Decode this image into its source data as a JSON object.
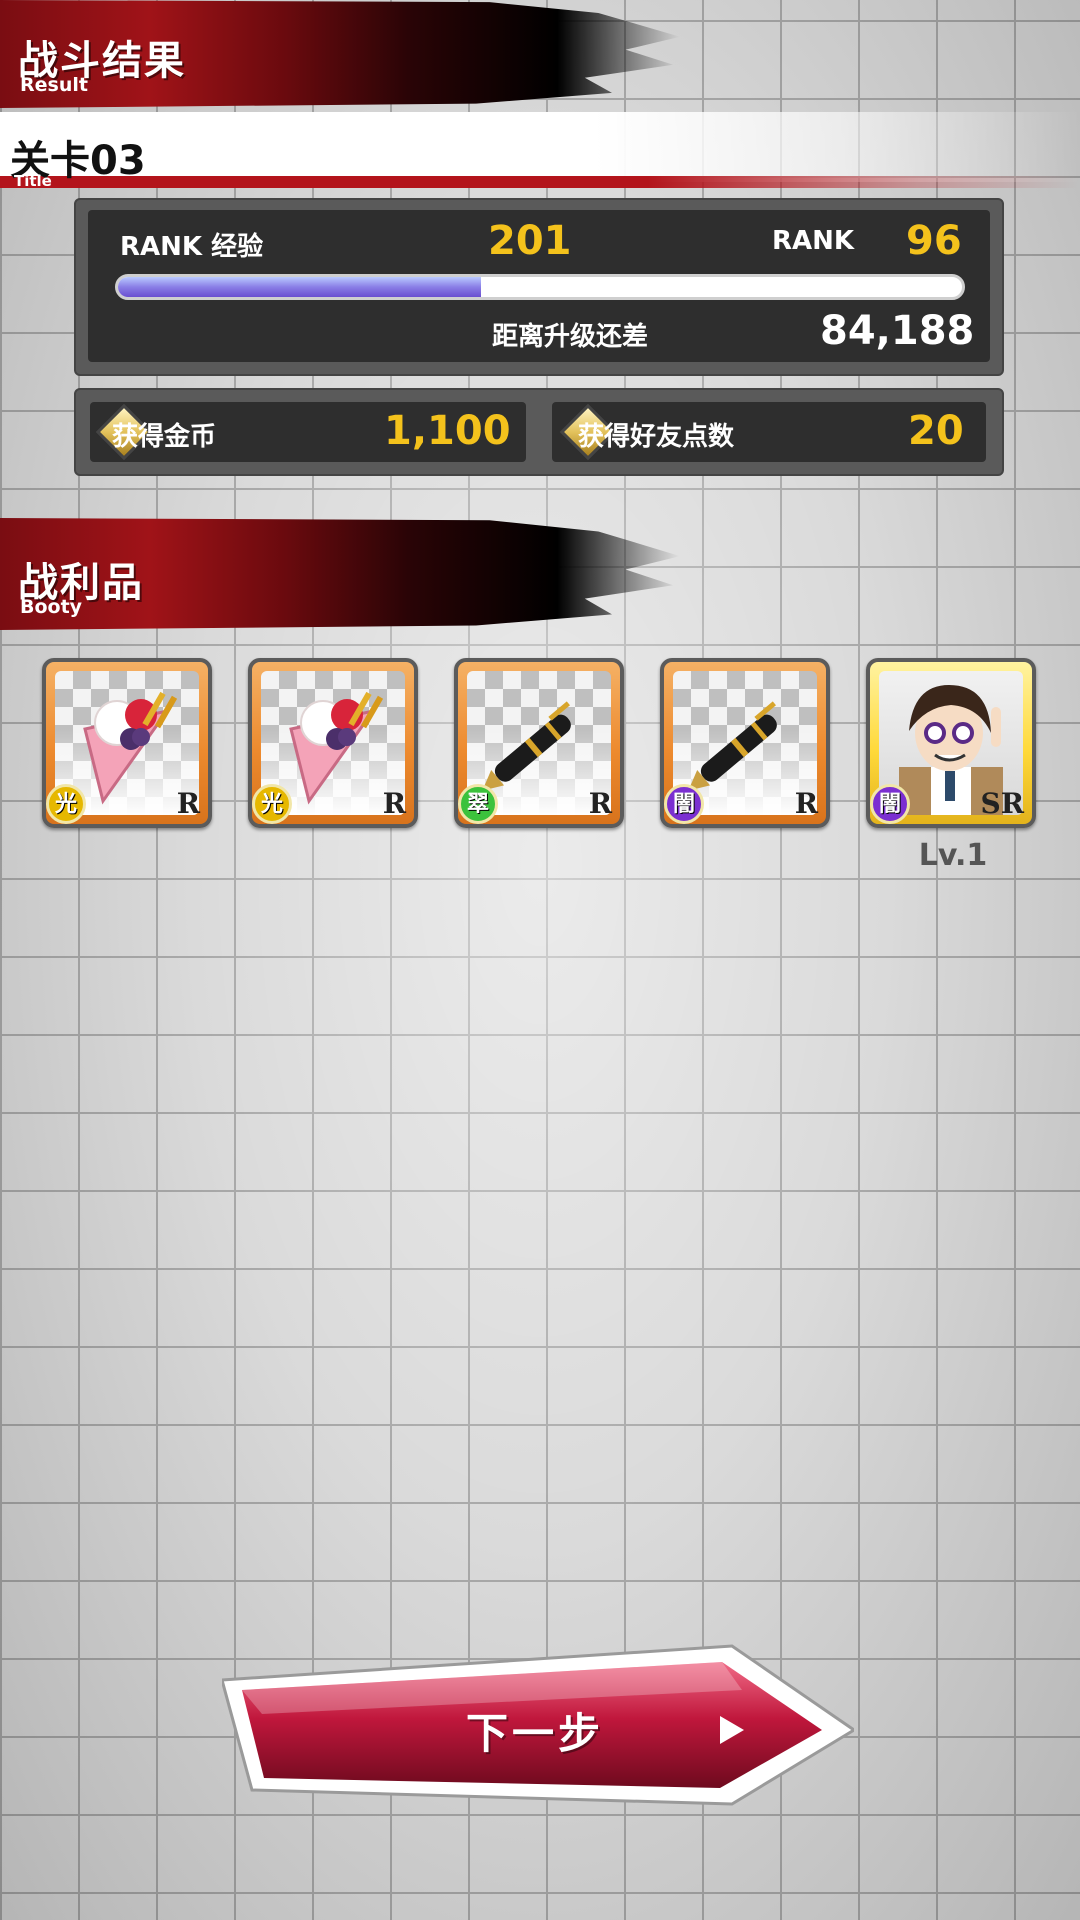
{
  "result_header": {
    "title": "战斗结果",
    "subtitle": "Result"
  },
  "stage": {
    "name": "关卡03",
    "subtitle": "Title"
  },
  "rank_panel": {
    "exp_label": "RANK 经验",
    "exp_value": "201",
    "rank_label": "RANK",
    "rank_value": "96",
    "progress_fraction": 0.43,
    "to_next_label": "距离升级还差",
    "to_next_value": "84,188"
  },
  "rewards": {
    "coins_label": "获得金币",
    "coins_value": "1,100",
    "friend_points_label": "获得好友点数",
    "friend_points_value": "20"
  },
  "booty_header": {
    "title": "战利品",
    "subtitle": "Booty"
  },
  "booty_items": [
    {
      "name": "crepe-item",
      "attribute": "光",
      "attribute_color": "#e6b800",
      "rarity": "R"
    },
    {
      "name": "crepe-item",
      "attribute": "光",
      "attribute_color": "#e6b800",
      "rarity": "R"
    },
    {
      "name": "fountain-pen-item",
      "attribute": "翠",
      "attribute_color": "#3cc23c",
      "rarity": "R"
    },
    {
      "name": "fountain-pen-item",
      "attribute": "闇",
      "attribute_color": "#7b2fd1",
      "rarity": "R"
    },
    {
      "name": "character-card",
      "attribute": "闇",
      "attribute_color": "#7b2fd1",
      "rarity": "SR",
      "level": "Lv.1"
    }
  ],
  "next_button": {
    "label": "下一步"
  },
  "colors": {
    "accent_red": "#b3141b",
    "gold": "#f4c21c"
  }
}
